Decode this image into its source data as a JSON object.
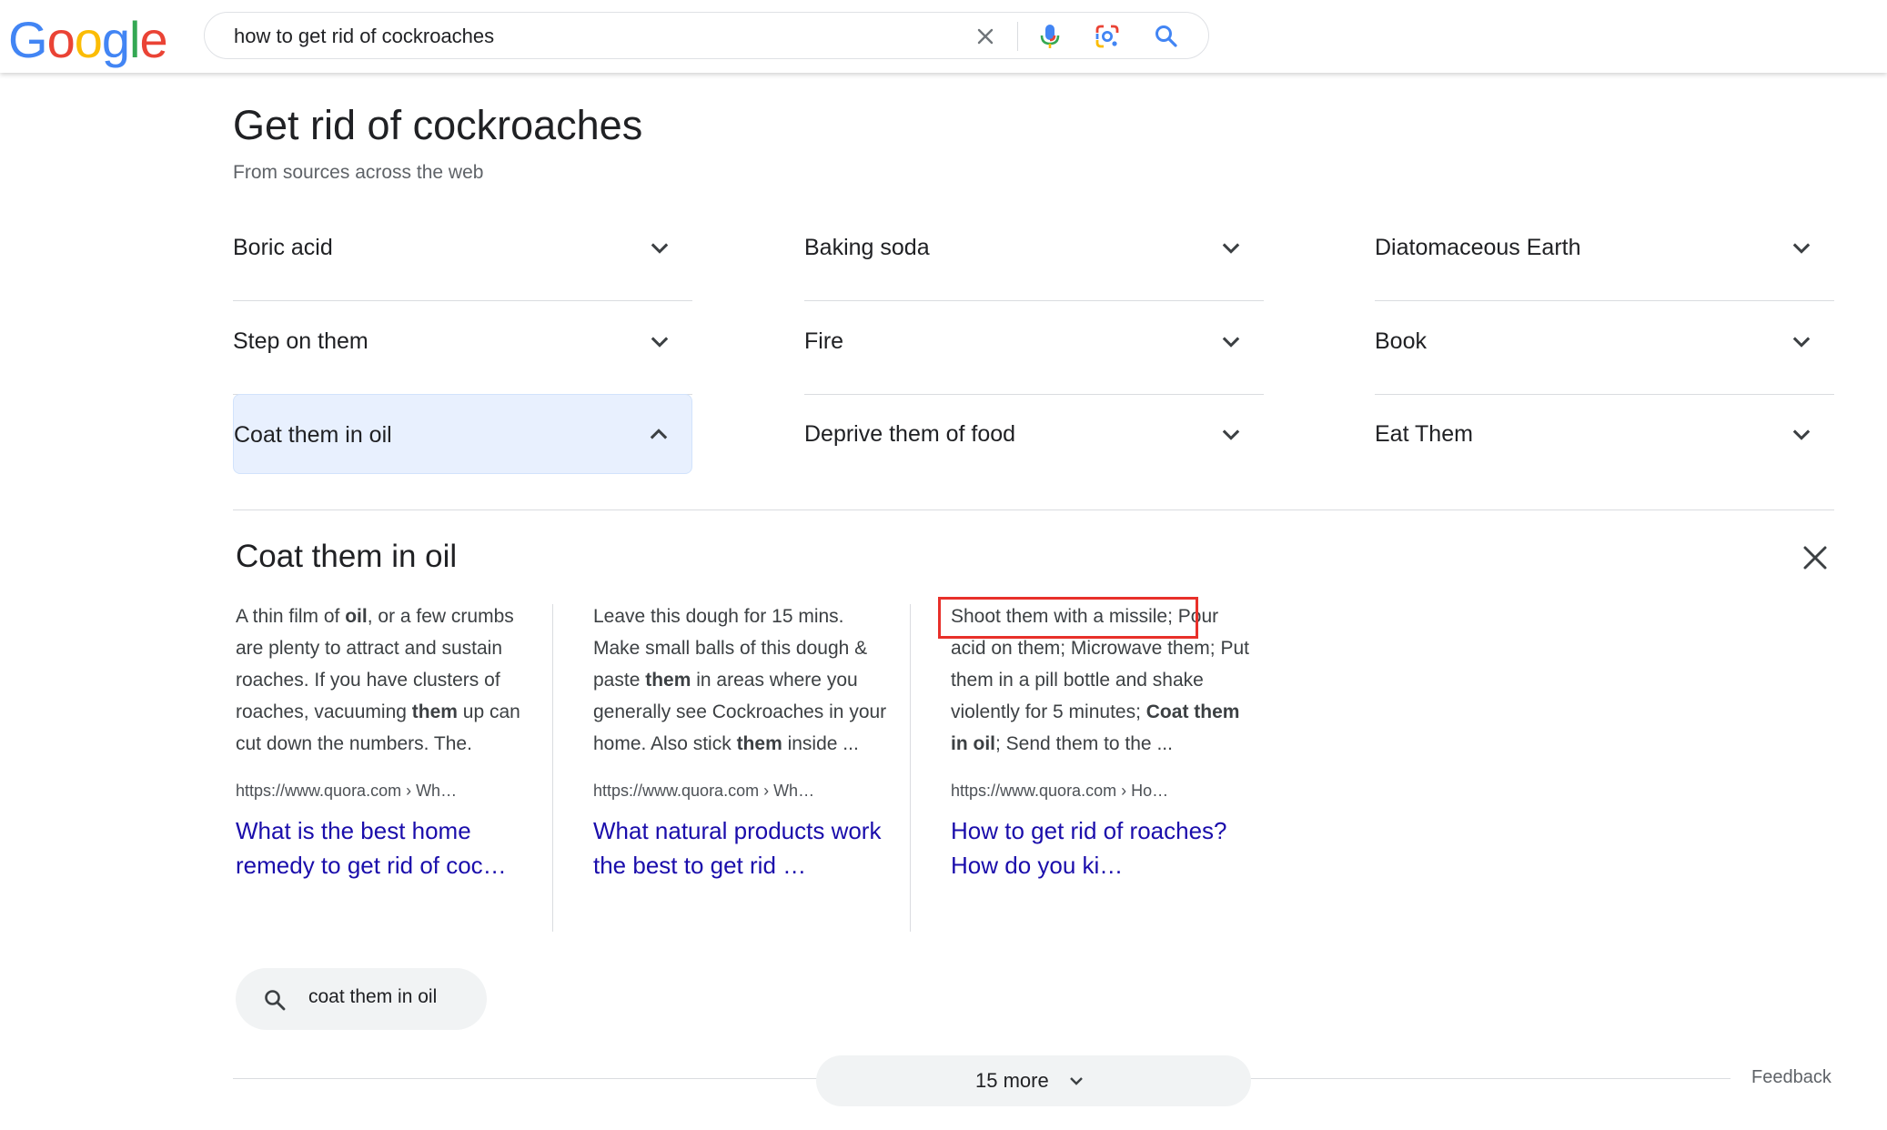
{
  "header": {
    "logo": [
      "G",
      "o",
      "o",
      "g",
      "l",
      "e"
    ],
    "logo_colors": [
      "#4285F4",
      "#EA4335",
      "#FBBC05",
      "#4285F4",
      "#34A853",
      "#EA4335"
    ],
    "search_query": "how to get rid of cockroaches",
    "icons": [
      "clear-icon",
      "microphone-icon",
      "lens-camera-icon",
      "search-icon"
    ]
  },
  "card": {
    "title": "Get rid of cockroaches",
    "subtitle": "From sources across the web",
    "items": [
      {
        "label": "Boric acid"
      },
      {
        "label": "Baking soda"
      },
      {
        "label": "Diatomaceous Earth"
      },
      {
        "label": "Step on them"
      },
      {
        "label": "Fire"
      },
      {
        "label": "Book"
      },
      {
        "label": "Coat them in oil",
        "expanded": true
      },
      {
        "label": "Deprive them of food"
      },
      {
        "label": "Eat Them"
      }
    ]
  },
  "detail": {
    "title": "Coat them in oil",
    "results": [
      {
        "snippet_parts": [
          {
            "t": "A thin film of ",
            "b": false
          },
          {
            "t": "oil",
            "b": true
          },
          {
            "t": ", or a few crumbs are plenty to attract and sustain roaches. If you have clusters of roaches, vacuuming ",
            "b": false
          },
          {
            "t": "them",
            "b": true
          },
          {
            "t": " up can cut down the numbers. The.",
            "b": false
          }
        ],
        "url": "https://www.quora.com › Wh…",
        "link": "What is the best home remedy to get rid of coc…"
      },
      {
        "snippet_parts": [
          {
            "t": "Leave this dough for 15 mins. Make small balls of this dough & paste ",
            "b": false
          },
          {
            "t": "them",
            "b": true
          },
          {
            "t": " in areas where you generally see Cockroaches in your home. Also stick ",
            "b": false
          },
          {
            "t": "them",
            "b": true
          },
          {
            "t": " inside ...",
            "b": false
          }
        ],
        "url": "https://www.quora.com › Wh…",
        "link": "What natural products work the best to get rid …"
      },
      {
        "snippet_parts": [
          {
            "t": "Shoot them with a missile;",
            "b": false
          },
          {
            "t": " Pour acid on them; Microwave them; Put them in a pill bottle and shake violently for 5 minutes; ",
            "b": false
          },
          {
            "t": "Coat them in oil",
            "b": true
          },
          {
            "t": "; Send them to the ...",
            "b": false
          }
        ],
        "url": "https://www.quora.com › Ho…",
        "link": "How to get rid of roaches? How do you ki…"
      }
    ],
    "chip_label": "coat them in oil"
  },
  "footer": {
    "more_label": "15 more",
    "feedback_label": "Feedback"
  },
  "colors": {
    "link": "#1a0dab",
    "highlight_box": "#e8302a",
    "active_item_bg": "#e8f0fe"
  }
}
